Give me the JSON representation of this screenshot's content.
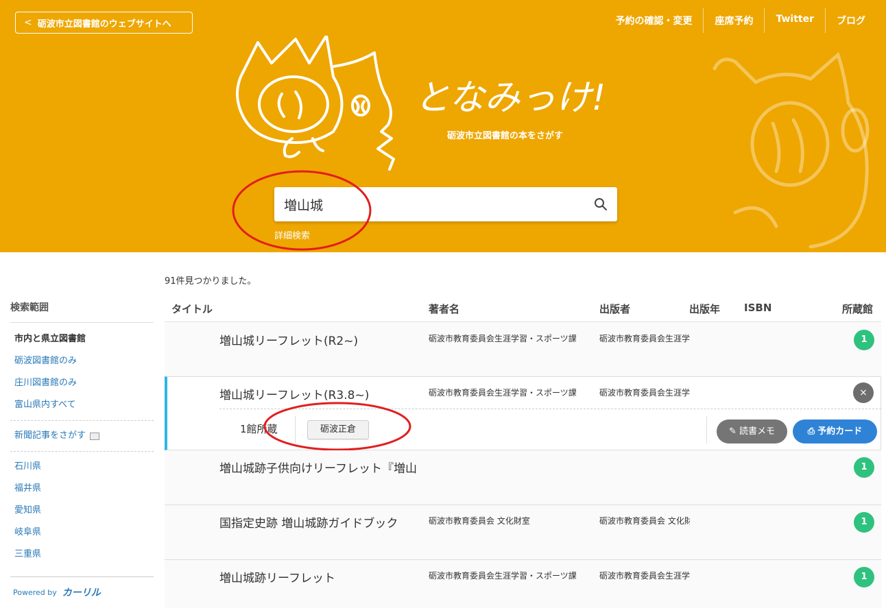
{
  "header": {
    "back_label": "砺波市立図書館のウェブサイトへ",
    "nav": [
      "予約の確認・変更",
      "座席予約",
      "Twitter",
      "ブログ"
    ],
    "logo_text": "となみっけ!",
    "tagline": "砺波市立図書館の本をさがす",
    "search_value": "増山城",
    "advanced_search": "詳細検索",
    "bg_color": "#eea600"
  },
  "sidebar": {
    "title": "検索範囲",
    "groups": [
      [
        "市内と県立図書館",
        "砺波図書館のみ",
        "庄川図書館のみ",
        "富山県内すべて"
      ],
      [
        "新聞記事をさがす"
      ],
      [
        "石川県",
        "福井県",
        "愛知県",
        "岐阜県",
        "三重県"
      ]
    ],
    "powered_by": "Powered by",
    "brand": "カーリル"
  },
  "results": {
    "count_text": "91件見つかりました。",
    "columns": [
      "タイトル",
      "著者名",
      "出版者",
      "出版年",
      "ISBN",
      "所蔵館"
    ],
    "rows": [
      {
        "title": "増山城リーフレット(R2~)",
        "author": "砺波市教育委員会生涯学習・スポーツ課",
        "publisher": "砺波市教育委員会生涯学",
        "count": "1"
      },
      {
        "title": "増山城リーフレット(R3.8~)",
        "author": "砺波市教育委員会生涯学習・スポーツ課",
        "publisher": "砺波市教育委員会生涯学",
        "expanded": true,
        "lib_count": "1館所蔵",
        "branch": "砺波正倉",
        "memo_label": "読書メモ",
        "reserve_label": "予約カード",
        "close": "×"
      },
      {
        "title": "増山城跡子供向けリーフレット『増山",
        "author": "",
        "publisher": "",
        "count": "1"
      },
      {
        "title": "国指定史跡 増山城跡ガイドブック",
        "author": "砺波市教育委員会 文化財室",
        "publisher": "砺波市教育委員会 文化財",
        "count": "1"
      },
      {
        "title": "増山城跡リーフレット",
        "author": "砺波市教育委員会生涯学習・スポーツ課",
        "publisher": "砺波市教育委員会生涯学",
        "count": "1"
      }
    ]
  }
}
